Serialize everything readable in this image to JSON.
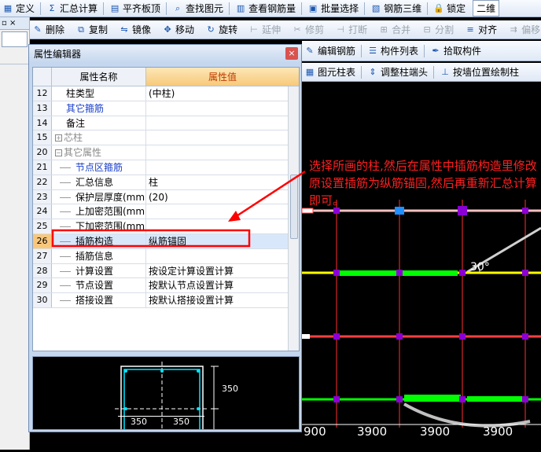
{
  "toolbar1": {
    "items": [
      {
        "icon": "grid-icon",
        "label": "定义"
      },
      {
        "icon": "sigma-icon",
        "label": "汇总计算"
      },
      {
        "icon": "plate-icon",
        "label": "平齐板顶"
      },
      {
        "icon": "find-icon",
        "label": "查找图元"
      },
      {
        "icon": "rebar-view-icon",
        "label": "查看钢筋量"
      },
      {
        "icon": "batch-select-icon",
        "label": "批量选择"
      },
      {
        "icon": "rebar-3d-icon",
        "label": "钢筋三维"
      },
      {
        "icon": "lock-icon",
        "label": "锁定"
      }
    ],
    "view_mode": "二维"
  },
  "toolbar2": {
    "items": [
      {
        "icon": "delete-icon",
        "label": "删除",
        "disabled": false
      },
      {
        "icon": "copy-icon",
        "label": "复制",
        "disabled": false
      },
      {
        "icon": "mirror-icon",
        "label": "镜像",
        "disabled": false
      },
      {
        "icon": "move-icon",
        "label": "移动",
        "disabled": false
      },
      {
        "icon": "rotate-icon",
        "label": "旋转",
        "disabled": false
      },
      {
        "icon": "extend-icon",
        "label": "延伸",
        "disabled": true
      },
      {
        "icon": "trim-icon",
        "label": "修剪",
        "disabled": true
      },
      {
        "icon": "break-icon",
        "label": "打断",
        "disabled": true
      },
      {
        "icon": "merge-icon",
        "label": "合并",
        "disabled": true
      },
      {
        "icon": "split-icon",
        "label": "分割",
        "disabled": true
      },
      {
        "icon": "align-icon",
        "label": "对齐",
        "disabled": false
      },
      {
        "icon": "offset-icon",
        "label": "偏移",
        "disabled": true
      }
    ]
  },
  "toolbar3": {
    "items": [
      {
        "icon": "edit-rebar-icon",
        "label": "编辑钢筋"
      },
      {
        "icon": "component-list-icon",
        "label": "构件列表"
      },
      {
        "icon": "pick-component-icon",
        "label": "拾取构件"
      }
    ]
  },
  "toolbar4": {
    "items": [
      {
        "icon": "column-table-icon",
        "label": "图元柱表"
      },
      {
        "icon": "adjust-column-end-icon",
        "label": "调整柱端头"
      },
      {
        "icon": "draw-by-wall-icon",
        "label": "按墙位置绘制柱"
      }
    ]
  },
  "dialog": {
    "title": "属性编辑器",
    "close": "×",
    "col_name": "属性名称",
    "col_value": "属性值",
    "rows": [
      {
        "n": "12",
        "name": "柱类型",
        "value": "(中柱)",
        "style": "",
        "indent": 1
      },
      {
        "n": "13",
        "name": "其它箍筋",
        "value": "",
        "style": "blue",
        "indent": 1
      },
      {
        "n": "14",
        "name": "备注",
        "value": "",
        "style": "",
        "indent": 1
      },
      {
        "n": "15",
        "name": "芯柱",
        "value": "",
        "style": "gray",
        "indent": 0,
        "expand": "+"
      },
      {
        "n": "20",
        "name": "其它属性",
        "value": "",
        "style": "gray",
        "indent": 0,
        "expand": "−"
      },
      {
        "n": "21",
        "name": "节点区箍筋",
        "value": "",
        "style": "blue",
        "indent": 2
      },
      {
        "n": "22",
        "name": "汇总信息",
        "value": "柱",
        "style": "",
        "indent": 2
      },
      {
        "n": "23",
        "name": "保护层厚度(mm)",
        "value": "(20)",
        "style": "",
        "indent": 2
      },
      {
        "n": "24",
        "name": "上加密范围(mm)",
        "value": "",
        "style": "",
        "indent": 2
      },
      {
        "n": "25",
        "name": "下加密范围(mm)",
        "value": "",
        "style": "",
        "indent": 2
      },
      {
        "n": "26",
        "name": "插筋构造",
        "value": "纵筋锚固",
        "style": "",
        "indent": 2,
        "selected": true
      },
      {
        "n": "27",
        "name": "插筋信息",
        "value": "",
        "style": "",
        "indent": 2
      },
      {
        "n": "28",
        "name": "计算设置",
        "value": "按设定计算设置计算",
        "style": "",
        "indent": 2
      },
      {
        "n": "29",
        "name": "节点设置",
        "value": "按默认节点设置计算",
        "style": "",
        "indent": 2
      },
      {
        "n": "30",
        "name": "搭接设置",
        "value": "按默认搭接设置计算",
        "style": "",
        "indent": 2
      }
    ]
  },
  "preview": {
    "dim_w1": "350",
    "dim_w2": "350",
    "dim_h1": "350",
    "dim_h2": "350"
  },
  "cad": {
    "angle_label": "30°",
    "axis_labels": [
      "900",
      "3900",
      "3900",
      "3900"
    ]
  },
  "annotation": "选择所画的柱,然后在属性中插筋构造里修改原设置插筋为纵筋锚固,然后再重新汇总计算即可。",
  "colors": {
    "annotation": "#ff2020",
    "highlight_box": "#ff0000",
    "beam_yellow": "#ffff00",
    "beam_green": "#00ff00",
    "beam_red": "#ff4040",
    "node_purple": "#8a00d4",
    "grid_red": "#ff3030"
  }
}
